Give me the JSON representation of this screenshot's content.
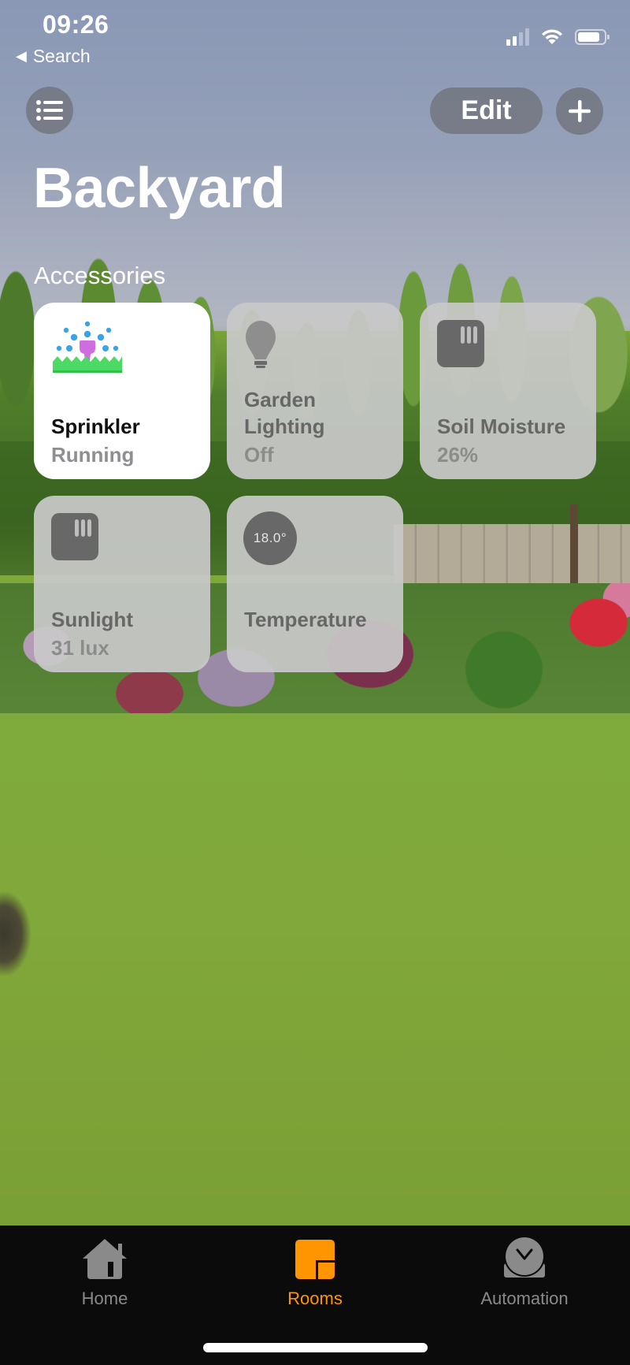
{
  "status_bar": {
    "time": "09:26",
    "back_label": "Search",
    "icons": [
      "cellular-signal-icon",
      "wifi-icon",
      "battery-icon"
    ]
  },
  "header": {
    "menu_icon": "list-icon",
    "edit_label": "Edit",
    "add_icon": "plus-icon",
    "title": "Backyard"
  },
  "section": {
    "title": "Accessories"
  },
  "accessories": [
    {
      "name": "Sprinkler",
      "status": "Running",
      "icon": "sprinkler-icon",
      "active": true
    },
    {
      "name": "Garden Lighting",
      "name_line1": "Garden",
      "name_line2": "Lighting",
      "status": "Off",
      "icon": "lightbulb-icon",
      "active": false
    },
    {
      "name": "Soil Moisture",
      "status": "26%",
      "icon": "sensor-icon",
      "active": false
    },
    {
      "name": "Sunlight",
      "status": "31 lux",
      "icon": "sensor-icon",
      "active": false
    },
    {
      "name": "Temperature",
      "status": "",
      "icon": "thermometer-reading-icon",
      "reading": "18.0°",
      "active": false
    }
  ],
  "tabbar": {
    "tabs": [
      {
        "label": "Home",
        "icon": "house-icon",
        "active": false
      },
      {
        "label": "Rooms",
        "icon": "rooms-icon",
        "active": true
      },
      {
        "label": "Automation",
        "icon": "clock-check-icon",
        "active": false
      }
    ]
  },
  "colors": {
    "accent": "#ff9500",
    "tile_active_bg": "#ffffff",
    "tile_inactive_bg": "#c8c8c8",
    "tabbar_bg": "#0b0b0b",
    "sprinkler_water": "#3aa3e3",
    "sprinkler_head": "#cf6de0",
    "sprinkler_grass": "#4cd964"
  }
}
